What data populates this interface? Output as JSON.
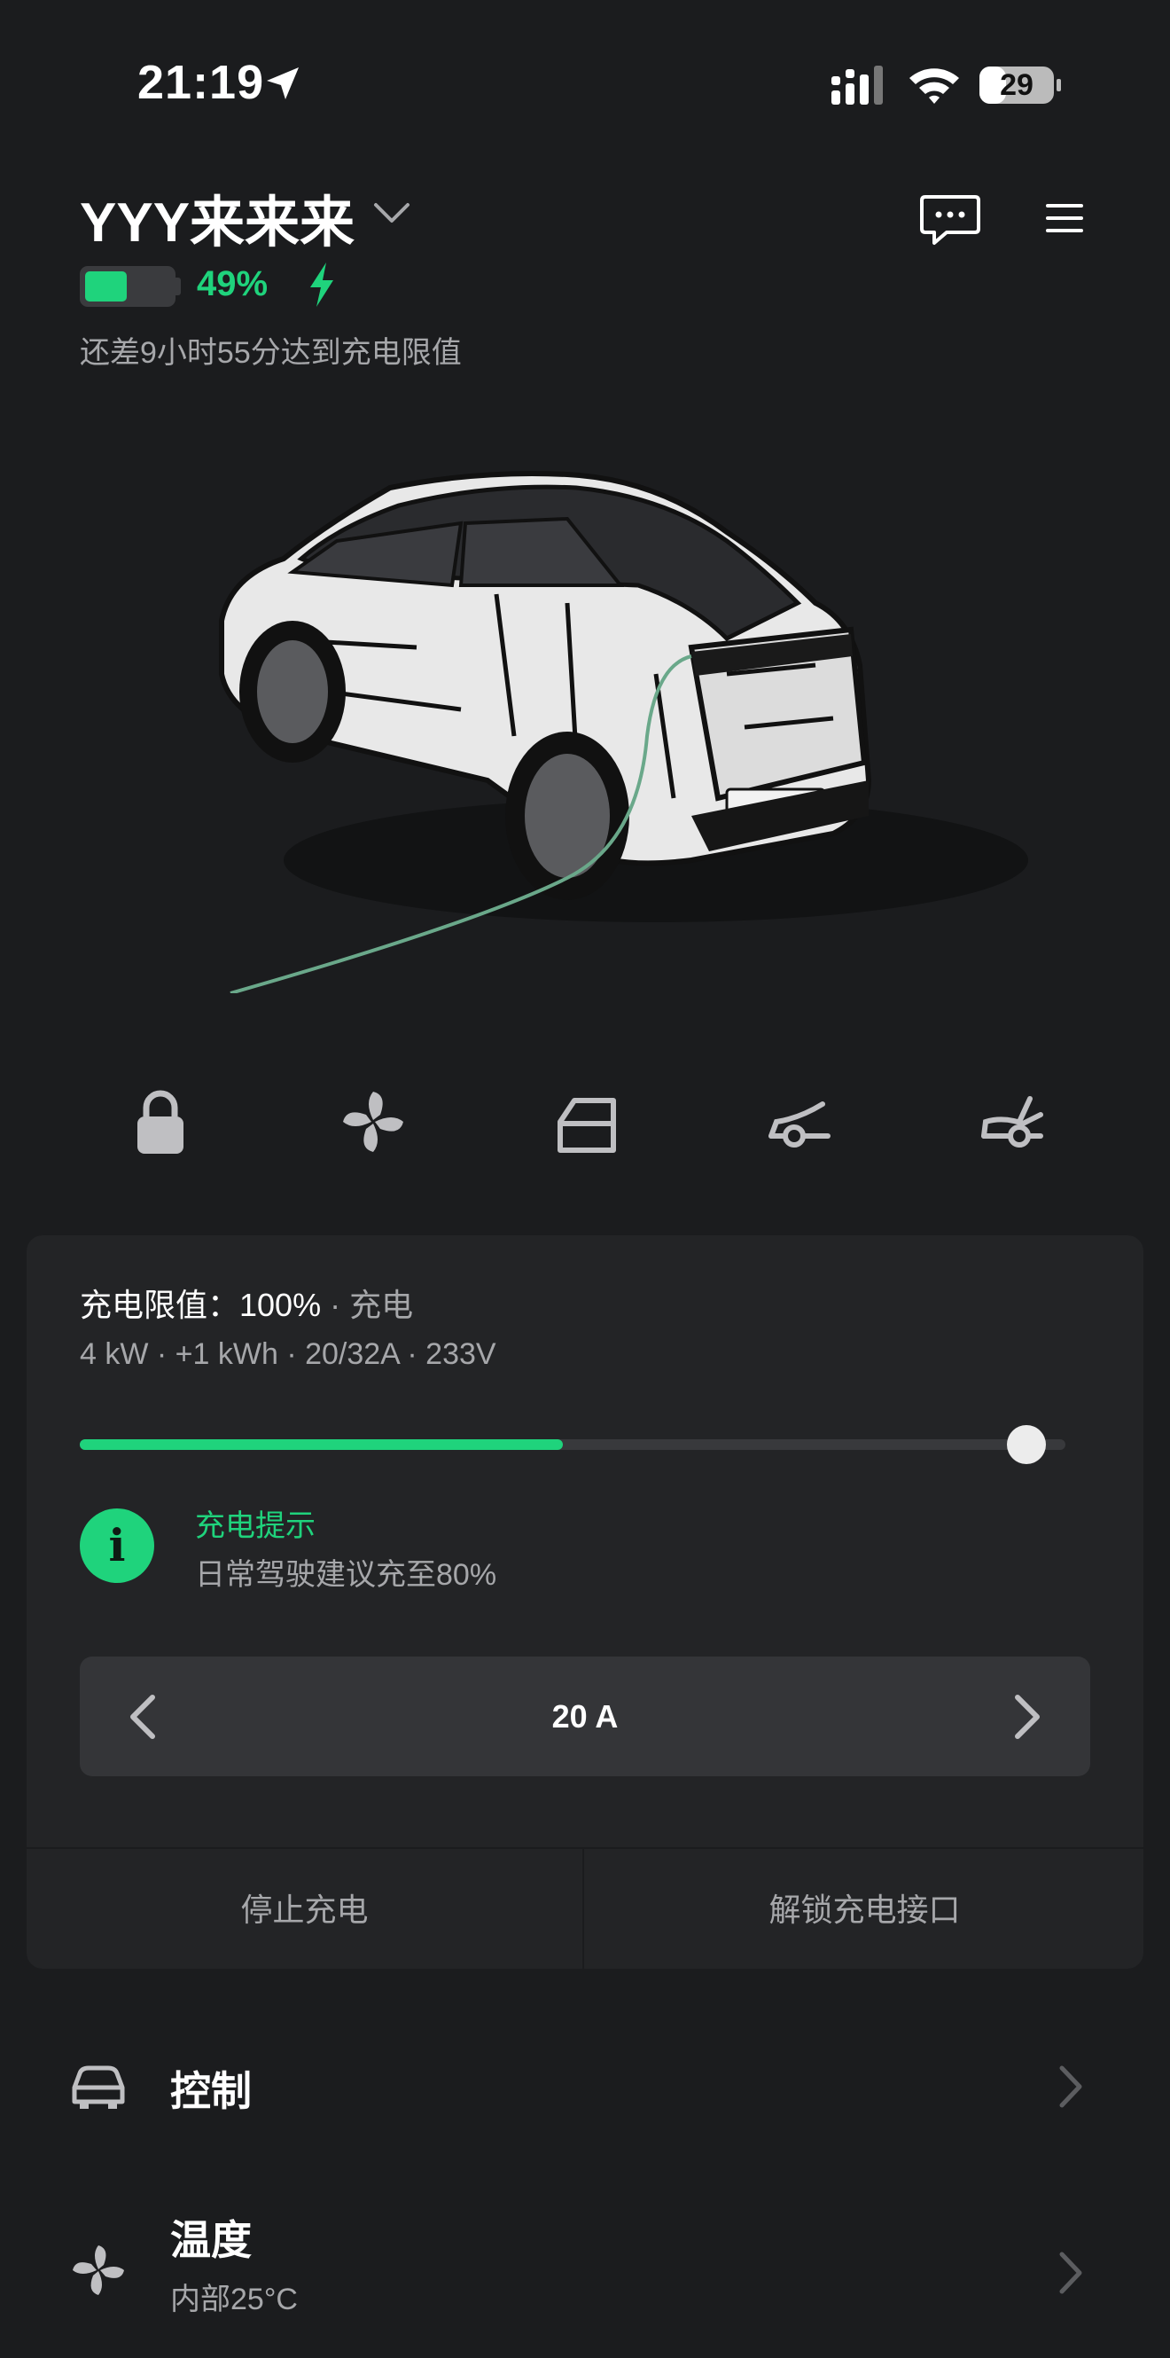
{
  "status_bar": {
    "time": "21:19",
    "battery": "29"
  },
  "header": {
    "car_name": "YYY来来来"
  },
  "battery": {
    "percent_text": "49%",
    "level": 0.49,
    "charge_eta": "还差9小时55分达到充电限值"
  },
  "quick_actions": [
    "lock-icon",
    "fan-icon",
    "door-icon",
    "frunk-icon",
    "trunk-icon"
  ],
  "charging": {
    "limit_label": "充电限值：",
    "limit_value": "100%",
    "separator": " · ",
    "mode": "充电",
    "stats": "4 kW  ·  +1 kWh  ·  20/32A  ·  233V",
    "progress": 0.49,
    "limit": 1.0,
    "tip_icon": "i",
    "tip_title": "充电提示",
    "tip_text": "日常驾驶建议充至80%",
    "amperage": "20 A",
    "stop_label": "停止充电",
    "unlock_label": "解锁充电接口"
  },
  "rows": {
    "control": {
      "title": "控制"
    },
    "climate": {
      "title": "温度",
      "subtitle": "内部25°C"
    }
  },
  "colors": {
    "accent": "#1fd37c",
    "background": "#1b1c1e",
    "card": "#232426"
  }
}
